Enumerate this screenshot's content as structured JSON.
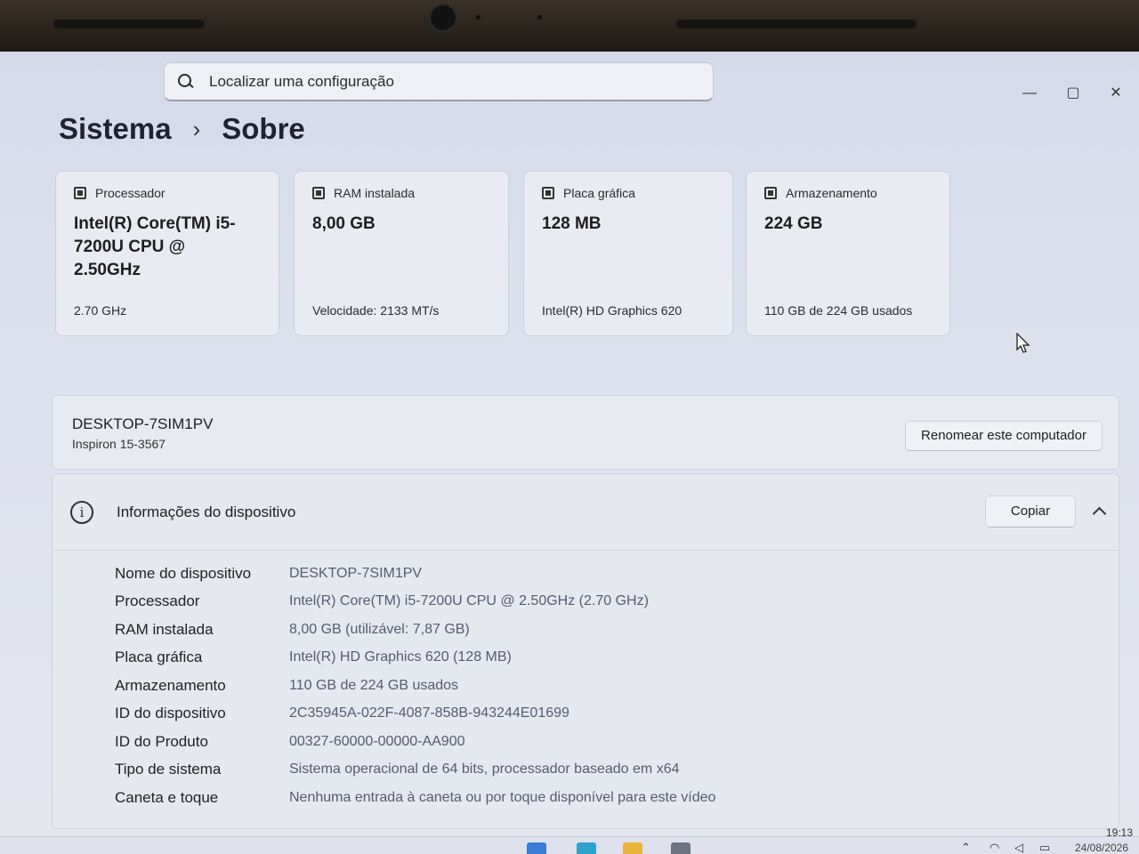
{
  "search": {
    "placeholder": "Localizar uma configuração"
  },
  "window_controls": {
    "minimize": "—",
    "maximize": "▢",
    "close": "✕"
  },
  "breadcrumb": {
    "parent": "Sistema",
    "separator": "›",
    "current": "Sobre"
  },
  "cards": [
    {
      "title": "Processador",
      "icon": "processor-icon",
      "value": "Intel(R) Core(TM) i5-7200U CPU @ 2.50GHz",
      "sub": "2.70 GHz"
    },
    {
      "title": "RAM instalada",
      "icon": "ram-icon",
      "value": "8,00 GB",
      "sub": "Velocidade: 2133 MT/s"
    },
    {
      "title": "Placa gráfica",
      "icon": "gpu-icon",
      "value": "128 MB",
      "sub": "Intel(R) HD Graphics 620"
    },
    {
      "title": "Armazenamento",
      "icon": "storage-icon",
      "value": "224 GB",
      "sub": "110 GB de 224 GB usados"
    }
  ],
  "computer": {
    "name": "DESKTOP-7SIM1PV",
    "model": "Inspiron 15-3567",
    "rename_label": "Renomear este computador"
  },
  "device_info": {
    "title": "Informações do dispositivo",
    "copy_label": "Copiar",
    "specs": [
      {
        "label": "Nome do dispositivo",
        "value": "DESKTOP-7SIM1PV"
      },
      {
        "label": "Processador",
        "value": "Intel(R) Core(TM) i5-7200U CPU @ 2.50GHz (2.70 GHz)"
      },
      {
        "label": "RAM instalada",
        "value": "8,00 GB (utilizável: 7,87 GB)"
      },
      {
        "label": "Placa gráfica",
        "value": "Intel(R) HD Graphics 620 (128 MB)"
      },
      {
        "label": "Armazenamento",
        "value": "110 GB de 224 GB usados"
      },
      {
        "label": "ID do dispositivo",
        "value": "2C35945A-022F-4087-858B-943244E01699"
      },
      {
        "label": "ID do Produto",
        "value": "00327-60000-00000-AA900"
      },
      {
        "label": "Tipo de sistema",
        "value": "Sistema operacional de 64 bits, processador baseado em x64"
      },
      {
        "label": "Caneta e toque",
        "value": "Nenhuma entrada à caneta ou por toque disponível para este vídeo"
      }
    ]
  },
  "taskbar": {
    "time": "19:13",
    "date": "24/08/2026"
  },
  "colors": {
    "accent": "#0067c0",
    "background": "#dde1ee"
  }
}
